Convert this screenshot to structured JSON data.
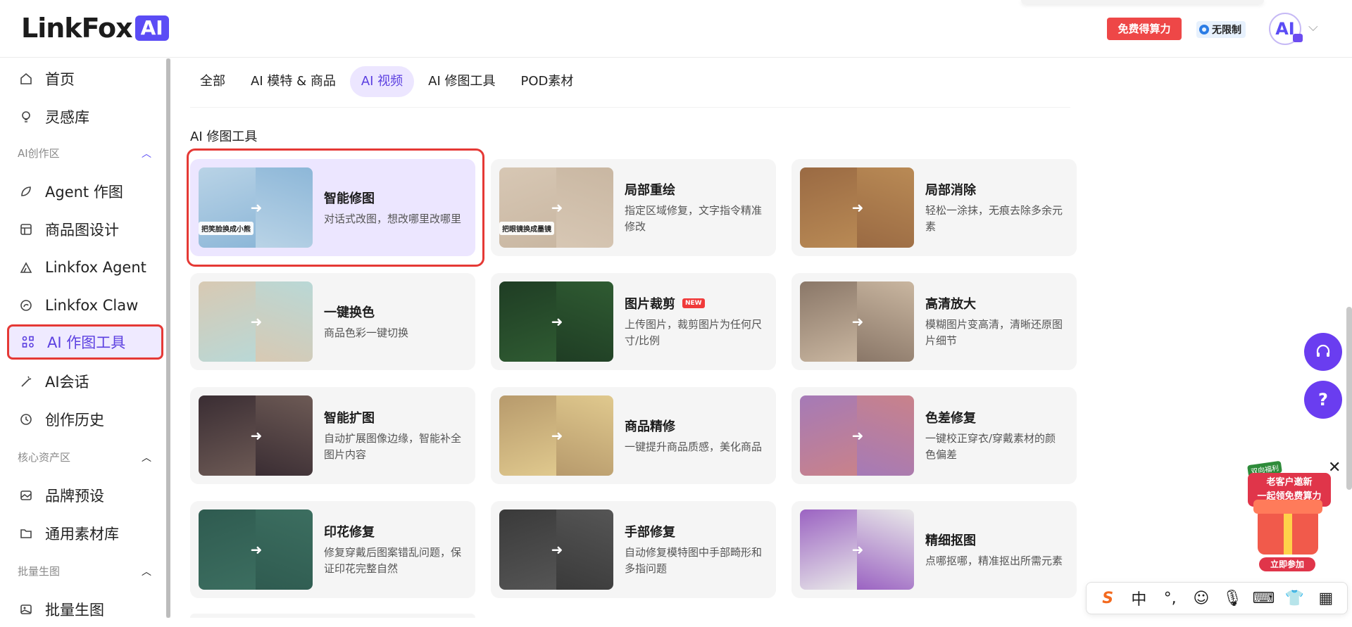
{
  "header": {
    "logo_text": "LinkFox",
    "logo_badge": "AI",
    "free_credits_button": "免费得算力",
    "plan_badge": "无限制",
    "avatar_text": "AI"
  },
  "sidebar": {
    "items": [
      {
        "label": "首页",
        "icon": "home-icon"
      },
      {
        "label": "灵感库",
        "icon": "lightbulb-icon"
      }
    ],
    "section_ai": "AI创作区",
    "ai_items": [
      {
        "label": "Agent 作图",
        "icon": "agent-icon"
      },
      {
        "label": "商品图设计",
        "icon": "layout-icon"
      },
      {
        "label": "Linkfox Agent",
        "icon": "agent-triangle-icon"
      },
      {
        "label": "Linkfox Claw",
        "icon": "claw-icon"
      },
      {
        "label": "AI 作图工具",
        "icon": "grid-tools-icon"
      },
      {
        "label": "AI会话",
        "icon": "magic-wand-icon"
      },
      {
        "label": "创作历史",
        "icon": "history-icon"
      }
    ],
    "section_assets": "核心资产区",
    "asset_items": [
      {
        "label": "品牌预设",
        "icon": "brand-icon"
      },
      {
        "label": "通用素材库",
        "icon": "folder-icon"
      }
    ],
    "section_batch": "批量生图",
    "batch_items": [
      {
        "label": "批量生图",
        "icon": "image-icon"
      }
    ]
  },
  "tabs": [
    "全部",
    "AI 模特 & 商品",
    "AI 视频",
    "AI 修图工具",
    "POD素材"
  ],
  "active_tab": "AI 视频",
  "section_title": "AI 修图工具",
  "cards": [
    {
      "title": "智能修图",
      "desc": "对话式改图，想改哪里改哪里",
      "tag": "把笑脸换成小熊",
      "colors": [
        "#b9d3e6",
        "#8db7d8"
      ]
    },
    {
      "title": "局部重绘",
      "desc": "指定区域修复，文字指令精准修改",
      "tag": "把眼镜换成墨镜",
      "colors": [
        "#d7c7b4",
        "#c9b7a2"
      ]
    },
    {
      "title": "局部消除",
      "desc": "轻松一涂抹，无痕去除多余元素",
      "tag": "",
      "colors": [
        "#9a6a43",
        "#b98a55"
      ]
    },
    {
      "title": "一键换色",
      "desc": "商品色彩一键切换",
      "tag": "",
      "colors": [
        "#d8c9b3",
        "#b9d8d6"
      ]
    },
    {
      "title": "图片裁剪",
      "desc": "上传图片，裁剪图片为任何尺寸/比例",
      "tag": "",
      "badge": "NEW",
      "colors": [
        "#1f3d24",
        "#2f5b32"
      ]
    },
    {
      "title": "高清放大",
      "desc": "模糊图片变高清，清晰还原图片细节",
      "tag": "",
      "colors": [
        "#8a7768",
        "#c9b6a0"
      ]
    },
    {
      "title": "智能扩图",
      "desc": "自动扩展图像边缘，智能补全图片内容",
      "tag": "",
      "colors": [
        "#3a2d33",
        "#6d5a55"
      ]
    },
    {
      "title": "商品精修",
      "desc": "一键提升商品质感，美化商品",
      "tag": "",
      "colors": [
        "#b79a6c",
        "#e0c98e"
      ]
    },
    {
      "title": "色差修复",
      "desc": "一键校正穿衣/穿戴素材的颜色偏差",
      "tag": "",
      "colors": [
        "#a57ab7",
        "#c9828a"
      ]
    },
    {
      "title": "印花修复",
      "desc": "修复穿戴后图案错乱问题，保证印花完整自然",
      "tag": "",
      "colors": [
        "#2f5b50",
        "#3c6e60"
      ]
    },
    {
      "title": "手部修复",
      "desc": "自动修复模特图中手部畸形和多指问题",
      "tag": "",
      "colors": [
        "#3a3a3a",
        "#555555"
      ]
    },
    {
      "title": "精细抠图",
      "desc": "点哪抠哪，精准抠出所需元素",
      "tag": "",
      "colors": [
        "#9b63c2",
        "#e9e9e9"
      ]
    }
  ],
  "promo": {
    "tag": "双向福利",
    "line1": "老客户邀新",
    "line2": "一起领免费算力",
    "button": "立即参加"
  },
  "ime": {
    "lang": "中"
  }
}
